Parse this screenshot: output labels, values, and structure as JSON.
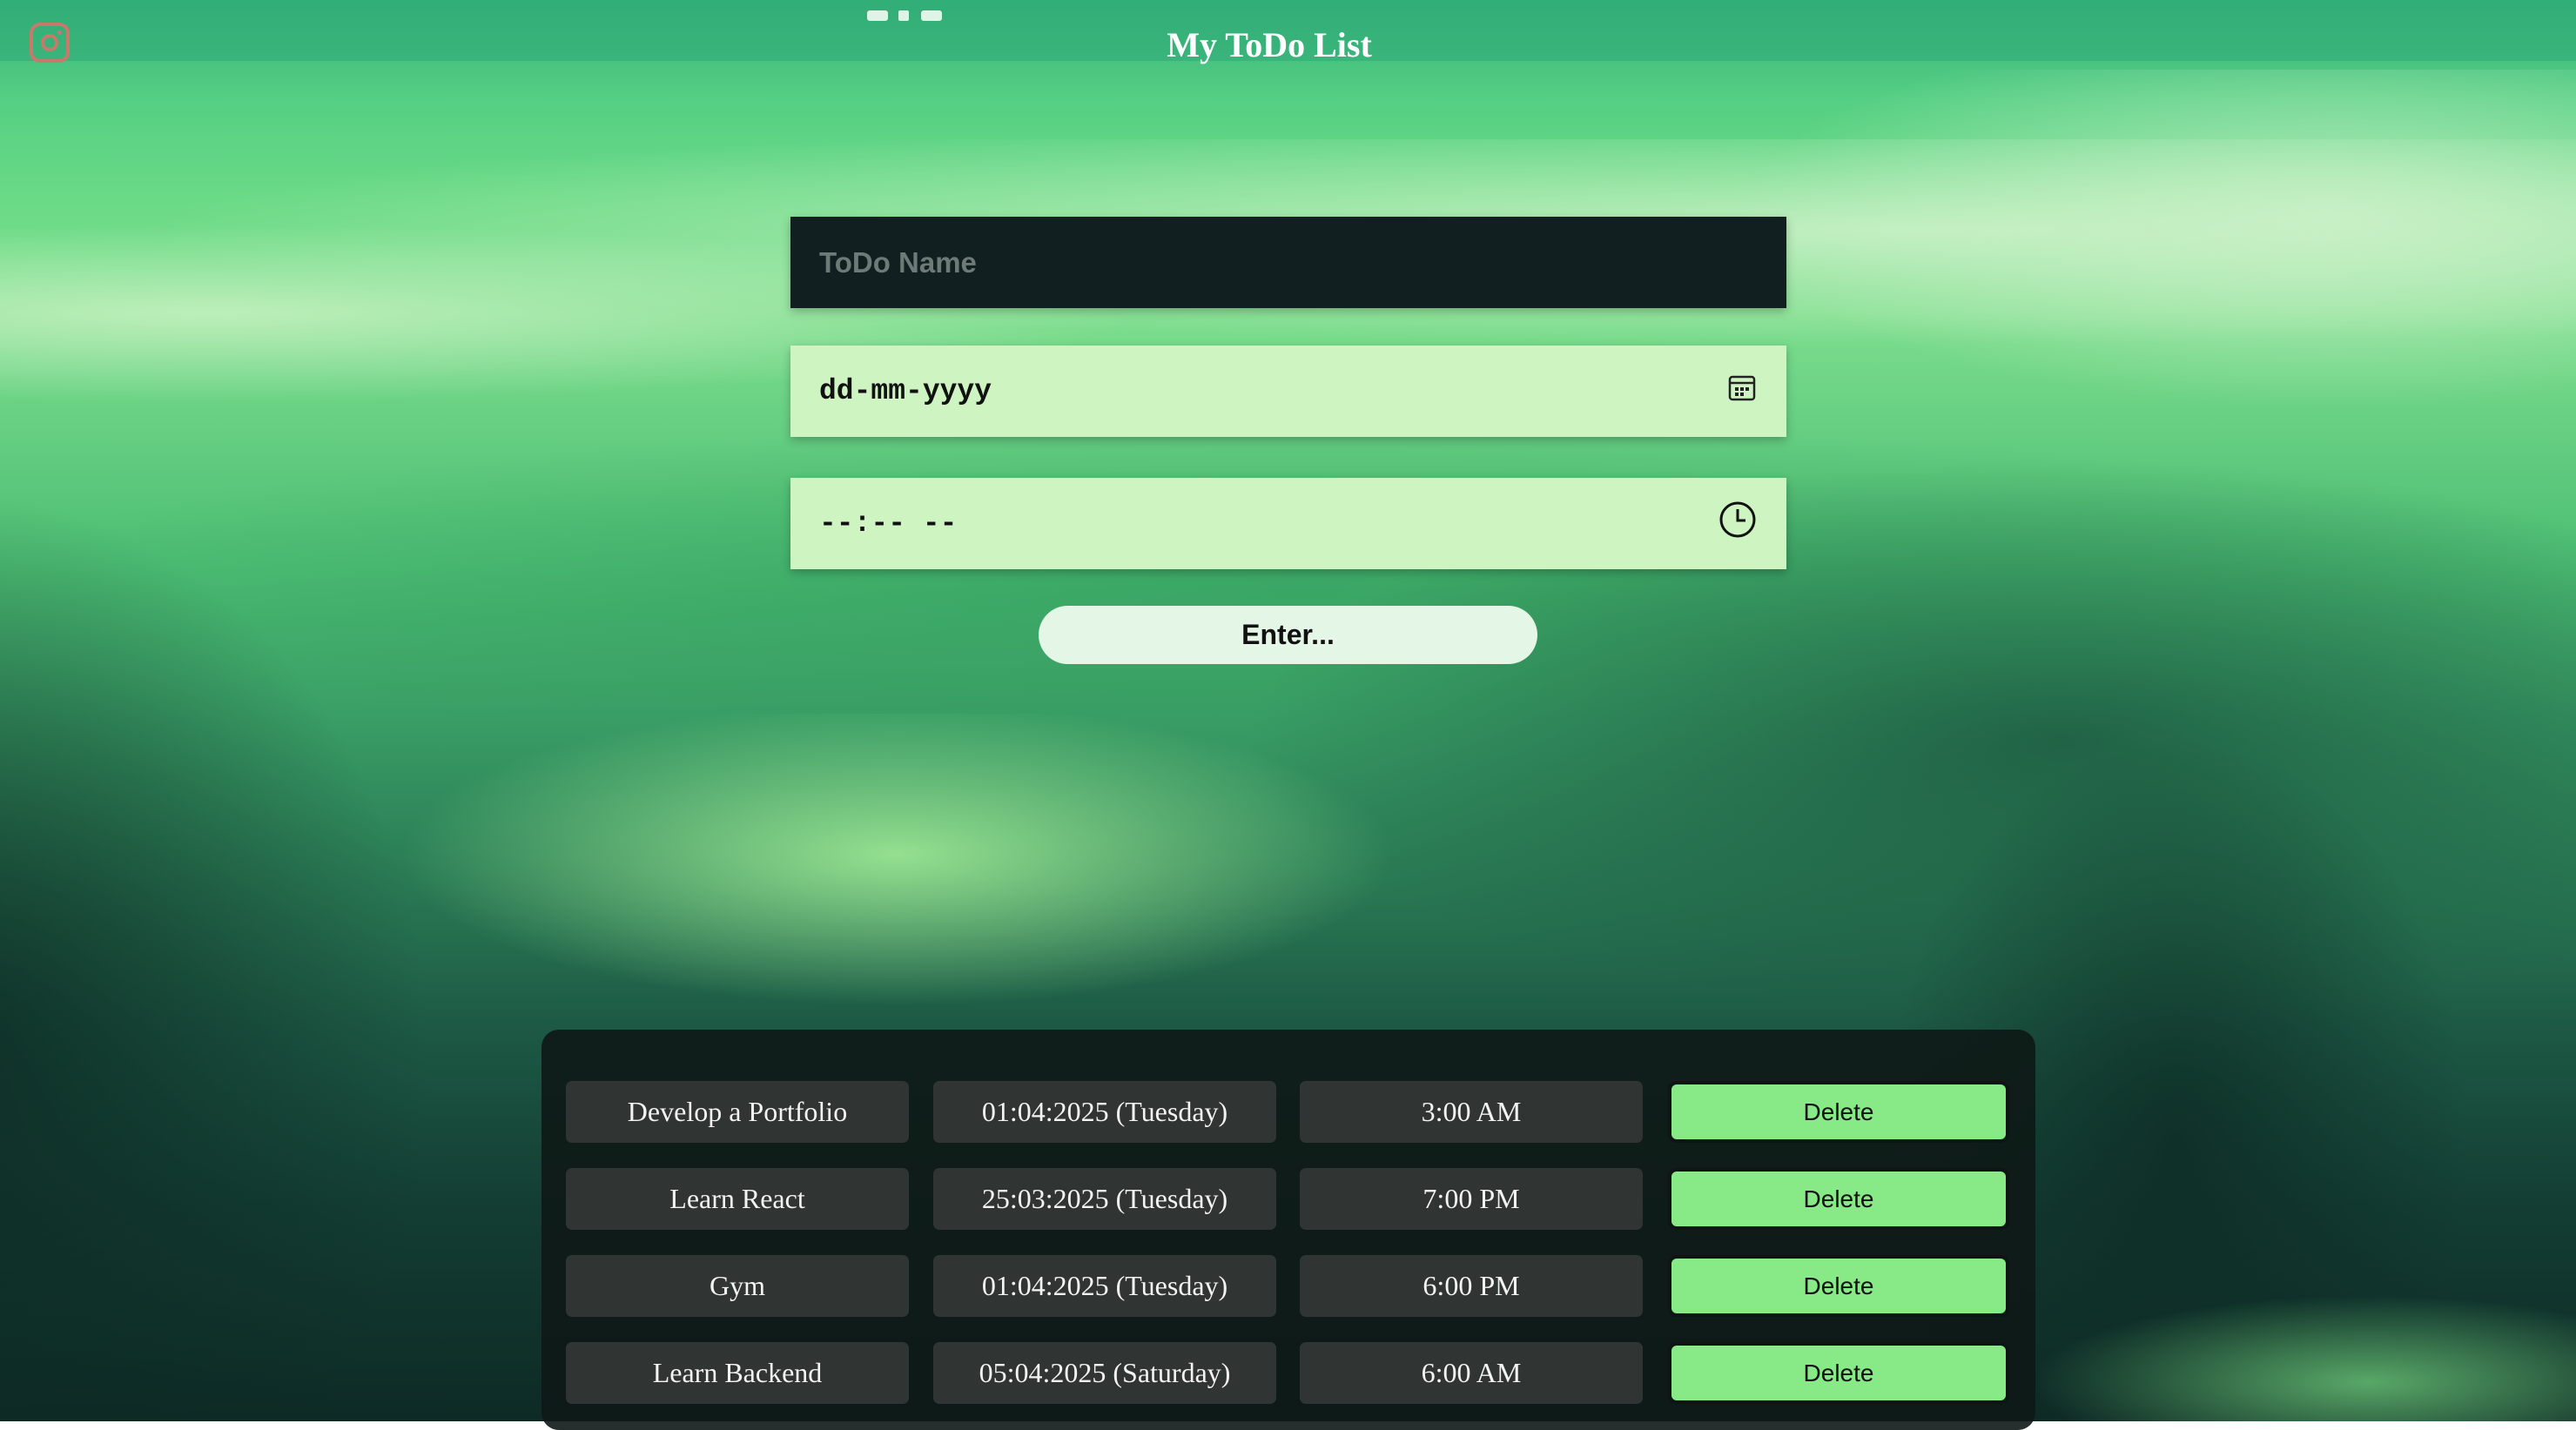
{
  "app": {
    "title": "My ToDo List",
    "instagram_icon": "instagram-icon"
  },
  "form": {
    "todo_name_placeholder": "ToDo Name",
    "date_placeholder": "dd-mm-yyyy",
    "time_placeholder": "--:-- --",
    "date_icon": "calendar-icon",
    "time_icon": "clock-icon",
    "enter_label": "Enter..."
  },
  "todos": [
    {
      "name": "Develop a Portfolio",
      "date": "01:04:2025 (Tuesday)",
      "time": "3:00 AM",
      "delete_label": "Delete"
    },
    {
      "name": "Learn React",
      "date": "25:03:2025 (Tuesday)",
      "time": "7:00 PM",
      "delete_label": "Delete"
    },
    {
      "name": "Gym",
      "date": "01:04:2025 (Tuesday)",
      "time": "6:00 PM",
      "delete_label": "Delete"
    },
    {
      "name": "Learn Backend",
      "date": "05:04:2025 (Saturday)",
      "time": "6:00 AM",
      "delete_label": "Delete"
    }
  ],
  "colors": {
    "input_dark": "#121f20",
    "input_light": "#cdf4c1",
    "enter_button": "#e4f7e6",
    "delete_button": "#88ea86",
    "title_text": "#ffffff"
  }
}
